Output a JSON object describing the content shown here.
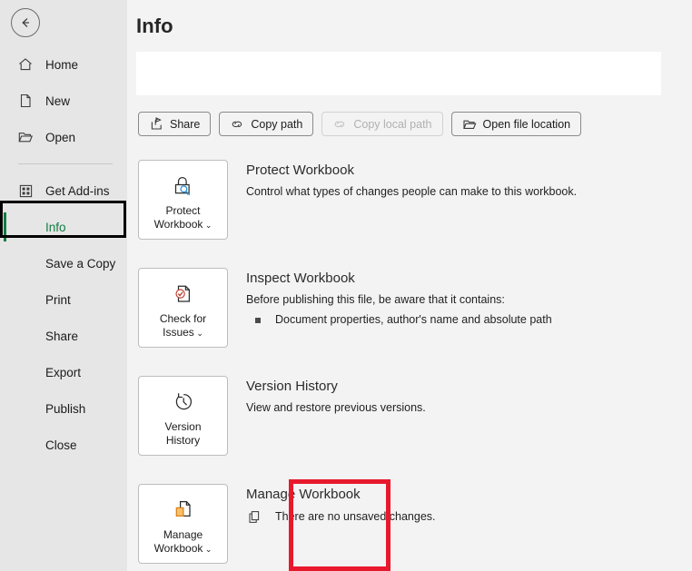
{
  "window": {
    "background_color": "#f3f3f3",
    "sidebar_color": "#e6e6e6",
    "accent_color": "#107c41",
    "highlight_color": "#e8192c"
  },
  "sidebar": {
    "back_button": {
      "icon": "back-arrow-icon",
      "label": "Back"
    },
    "items": [
      {
        "label": "Home",
        "icon": "home-icon",
        "selected": false
      },
      {
        "label": "New",
        "icon": "new-doc-icon",
        "selected": false
      },
      {
        "label": "Open",
        "icon": "folder-open-icon",
        "selected": false
      },
      {
        "label": "Get Add-ins",
        "icon": "add-ins-icon",
        "selected": false
      },
      {
        "label": "Info",
        "icon": "",
        "selected": true
      },
      {
        "label": "Save a Copy",
        "icon": "",
        "selected": false
      },
      {
        "label": "Print",
        "icon": "",
        "selected": false
      },
      {
        "label": "Share",
        "icon": "",
        "selected": false
      },
      {
        "label": "Export",
        "icon": "",
        "selected": false
      },
      {
        "label": "Publish",
        "icon": "",
        "selected": false
      },
      {
        "label": "Close",
        "icon": "",
        "selected": false
      }
    ]
  },
  "main": {
    "page_title": "Info",
    "filename_panel": {
      "text": ""
    },
    "toolbar": [
      {
        "label": "Share",
        "icon": "share-icon",
        "disabled": false
      },
      {
        "label": "Copy path",
        "icon": "link-icon",
        "disabled": false
      },
      {
        "label": "Copy local path",
        "icon": "link-icon",
        "disabled": true
      },
      {
        "label": "Open file location",
        "icon": "folder-open-icon",
        "disabled": false
      }
    ],
    "sections": [
      {
        "id": "protect-workbook",
        "button_label_line1": "Protect",
        "button_label_line2": "Workbook",
        "has_chevron": true,
        "icon": "lock-key-icon",
        "title": "Protect Workbook",
        "description": "Control what types of changes people can make to this workbook.",
        "bullets": [],
        "status": null,
        "highlighted": false
      },
      {
        "id": "inspect-workbook",
        "button_label_line1": "Check for",
        "button_label_line2": "Issues",
        "has_chevron": true,
        "icon": "document-check-icon",
        "title": "Inspect Workbook",
        "description": "Before publishing this file, be aware that it contains:",
        "bullets": [
          "Document properties, author's name and absolute path"
        ],
        "status": null,
        "highlighted": false
      },
      {
        "id": "version-history",
        "button_label_line1": "Version",
        "button_label_line2": "History",
        "has_chevron": false,
        "icon": "history-clock-icon",
        "title": "Version History",
        "description": "View and restore previous versions.",
        "bullets": [],
        "status": null,
        "highlighted": false
      },
      {
        "id": "manage-workbook",
        "button_label_line1": "Manage",
        "button_label_line2": "Workbook",
        "has_chevron": true,
        "icon": "manage-docs-icon",
        "title": "Manage Workbook",
        "description": "",
        "bullets": [],
        "status": {
          "icon": "unsaved-docs-icon",
          "text": "There are no unsaved changes."
        },
        "highlighted": true
      }
    ]
  }
}
